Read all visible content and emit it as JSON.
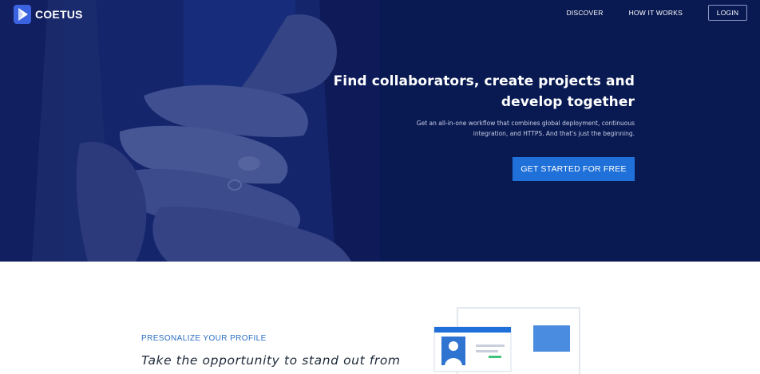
{
  "brand": {
    "name": "COETUS",
    "accent": "#1f71d9",
    "navy": "#091a52"
  },
  "nav": {
    "links": [
      "DISCOVER",
      "HOW IT WORKS"
    ],
    "login": "LOGIN"
  },
  "hero": {
    "title": "Find collaborators, create projects and develop together",
    "subtitle": "Get an all-in-one workflow that combines global deployment, continuous integration, and HTTPS. And that's just the beginning.",
    "cta": "GET STARTED FOR FREE",
    "image": "stacked-hands-photo"
  },
  "feature": {
    "eyebrow": "PRESONALIZE YOUR PROFILE",
    "lead": "Take the opportunity to stand out from",
    "illustration": "profile-card-illustration"
  }
}
